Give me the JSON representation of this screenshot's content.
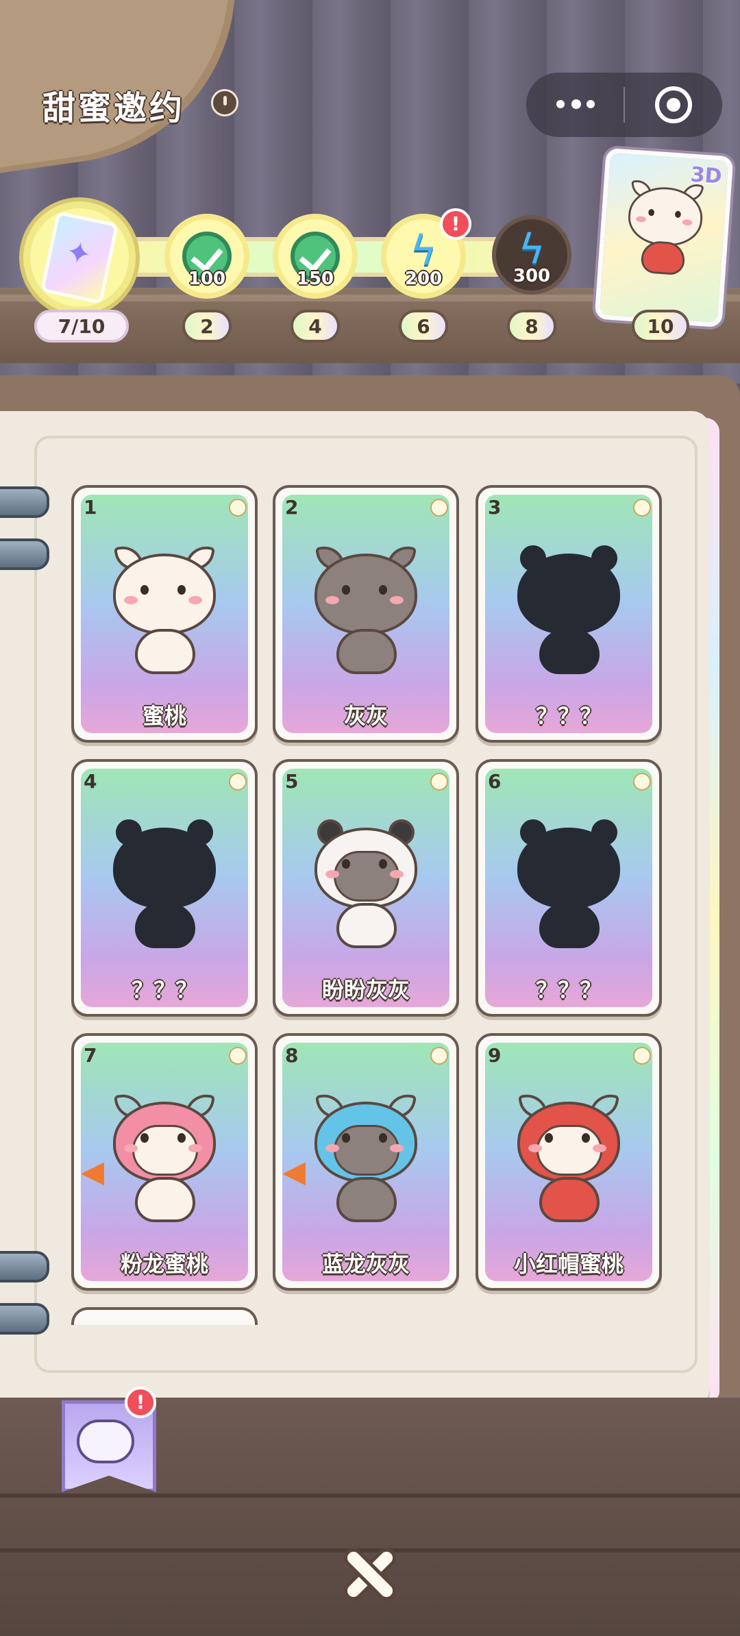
{
  "header": {
    "title": "甜蜜邀约",
    "help_icon": "clock-icon"
  },
  "capsule": {
    "more_icon": "more-dots-icon",
    "close_icon": "target-close-icon"
  },
  "progress": {
    "current": "7/10",
    "reward_badge": "3D",
    "milestones": [
      {
        "step": "2",
        "points": "100",
        "state": "claimed",
        "icon": "check-icon"
      },
      {
        "step": "4",
        "points": "150",
        "state": "claimed",
        "icon": "check-icon"
      },
      {
        "step": "6",
        "points": "200",
        "state": "claimable",
        "icon": "energy-bolt-icon",
        "alert": "!"
      },
      {
        "step": "8",
        "points": "300",
        "state": "locked",
        "icon": "energy-bolt-icon"
      },
      {
        "step": "10",
        "points": "",
        "state": "reward-card",
        "icon": "cat-card-icon"
      }
    ]
  },
  "cards": [
    {
      "no": "1",
      "name": "蜜桃",
      "style": "white"
    },
    {
      "no": "2",
      "name": "灰灰",
      "style": "gray"
    },
    {
      "no": "3",
      "name": "？？？",
      "style": "shadow-char"
    },
    {
      "no": "4",
      "name": "？？？",
      "style": "shadow-char"
    },
    {
      "no": "5",
      "name": "盼盼灰灰",
      "style": "hood-panda"
    },
    {
      "no": "6",
      "name": "？？？",
      "style": "shadow-char"
    },
    {
      "no": "7",
      "name": "粉龙蜜桃",
      "style": "hood-pink"
    },
    {
      "no": "8",
      "name": "蓝龙灰灰",
      "style": "hood-blue"
    },
    {
      "no": "9",
      "name": "小红帽蜜桃",
      "style": "hood-red"
    }
  ],
  "bookmark": {
    "alert": "!",
    "icon": "mascot-bookmark-icon"
  },
  "close": {
    "icon": "close-x-icon"
  },
  "colors": {
    "accent_yellow": "#fff9b0",
    "alert_red": "#f04e5a",
    "card_border": "#6a5b52"
  }
}
